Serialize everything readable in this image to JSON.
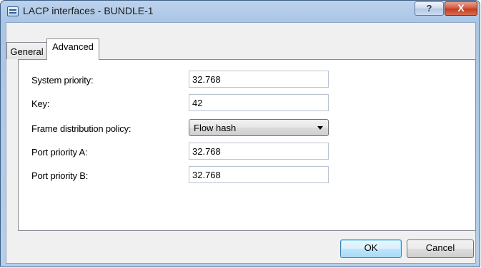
{
  "window": {
    "title": "LACP interfaces - BUNDLE-1",
    "help_label": "?",
    "close_label": "X"
  },
  "tabs": [
    {
      "label": "General",
      "active": false
    },
    {
      "label": "Advanced",
      "active": true
    }
  ],
  "form": {
    "system_priority": {
      "label": "System priority:",
      "value": "32.768"
    },
    "key": {
      "label": "Key:",
      "value": "42"
    },
    "frame_distribution_policy": {
      "label": "Frame distribution policy:",
      "value": "Flow hash"
    },
    "port_priority_a": {
      "label": "Port priority A:",
      "value": "32.768"
    },
    "port_priority_b": {
      "label": "Port priority B:",
      "value": "32.768"
    }
  },
  "buttons": {
    "ok": "OK",
    "cancel": "Cancel"
  }
}
